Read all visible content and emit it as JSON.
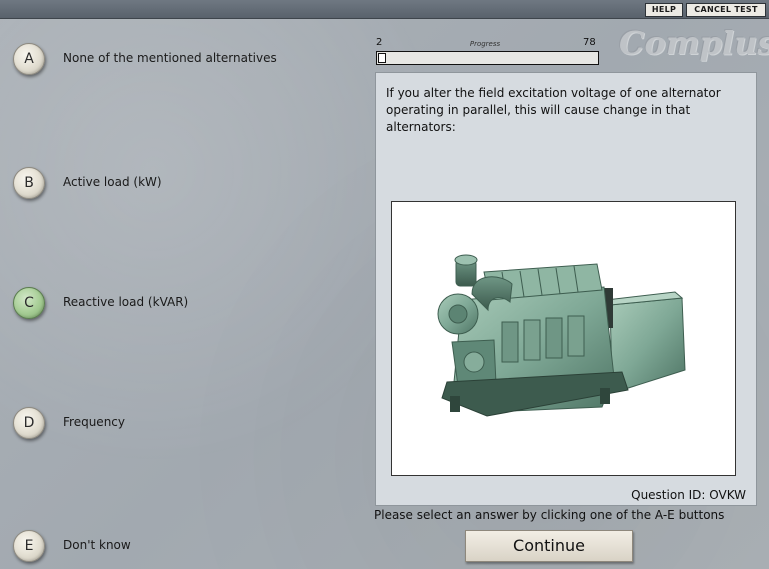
{
  "topbar": {
    "help_label": "HELP",
    "cancel_label": "CANCEL TEST"
  },
  "logo": {
    "text": "Complus"
  },
  "progress": {
    "min_label": "2",
    "max_label": "78",
    "label": "Progress",
    "fraction": 0.026
  },
  "answers": [
    {
      "letter": "A",
      "text": "None of the mentioned alternatives",
      "selected": false
    },
    {
      "letter": "B",
      "text": "Active load (kW)",
      "selected": false
    },
    {
      "letter": "C",
      "text": "Reactive load (kVAR)",
      "selected": true
    },
    {
      "letter": "D",
      "text": "Frequency",
      "selected": false
    },
    {
      "letter": "E",
      "text": "Don't know",
      "selected": false
    }
  ],
  "question": {
    "text": "If you alter the field excitation voltage of one alternator operating in parallel, this will cause change in that alternators:",
    "id_text": "Question ID: OVKW",
    "image_icon": "diesel-generator-image"
  },
  "instruction": "Please select an answer by clicking one of the A-E buttons",
  "continue_label": "Continue",
  "colors": {
    "background": "#a7adb3",
    "selected_answer": "#a9cf98",
    "panel": "#d6dbe0",
    "engine": "#7fa896"
  }
}
